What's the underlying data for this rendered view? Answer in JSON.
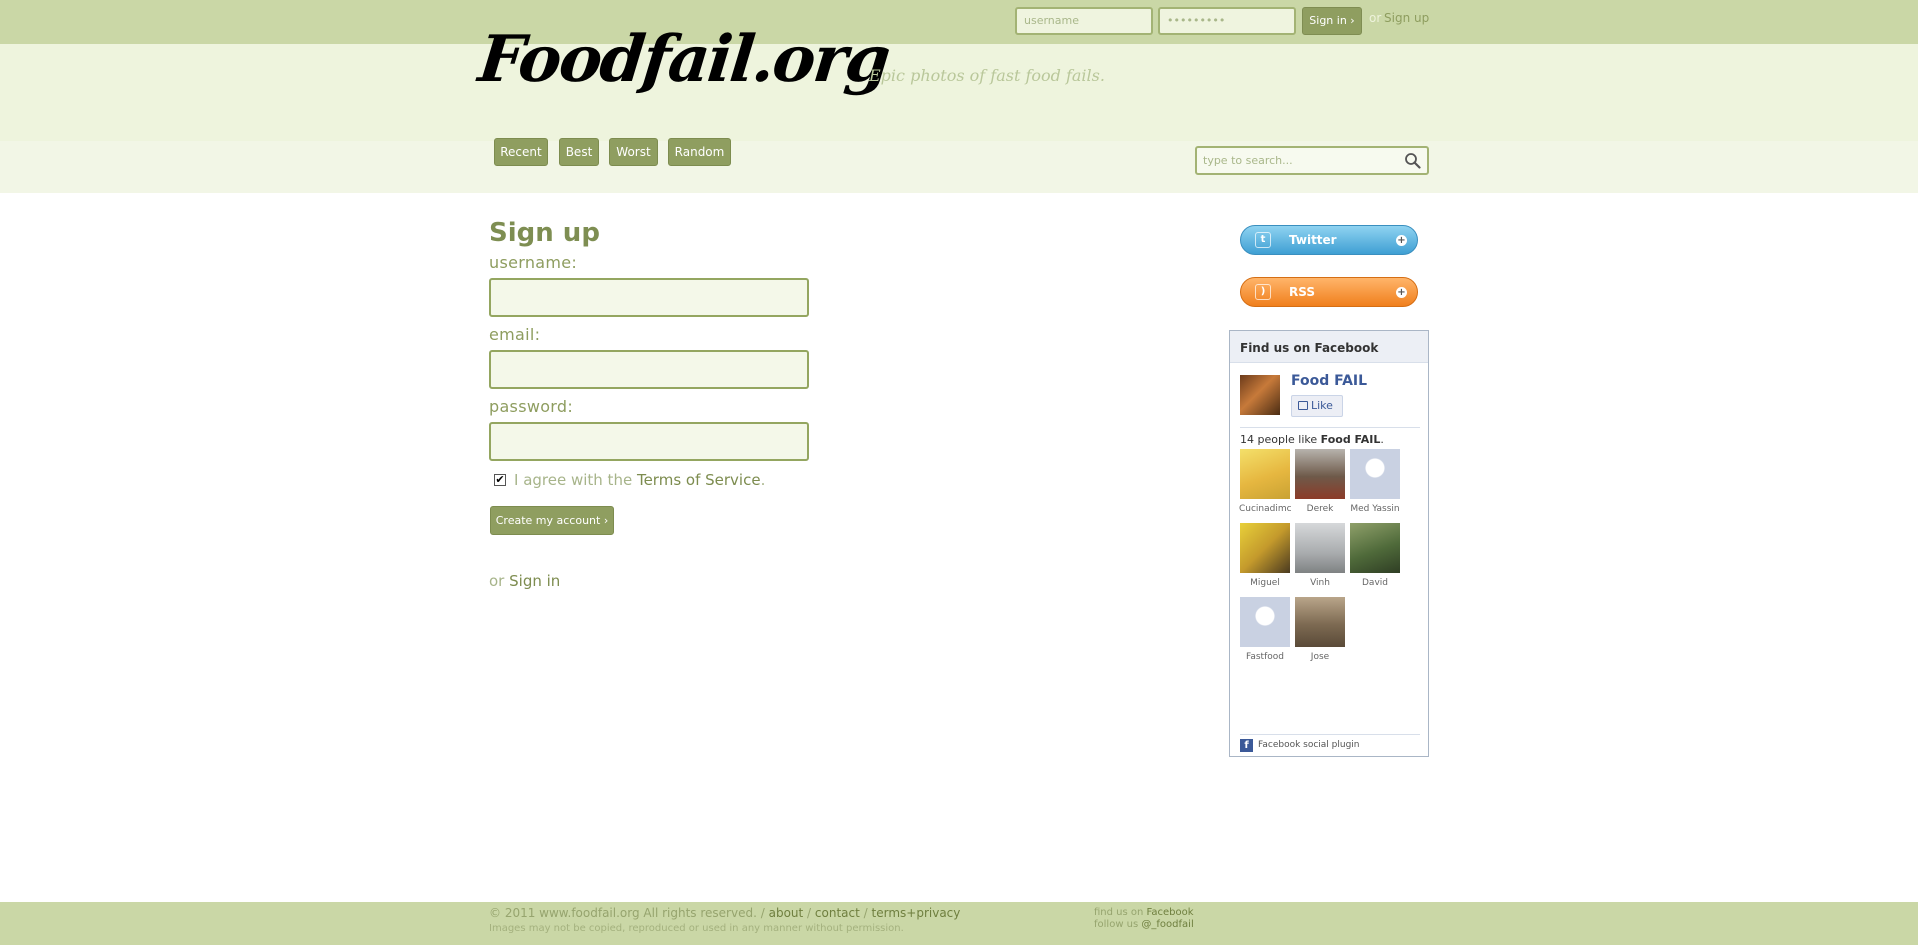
{
  "topbar": {
    "username_placeholder": "username",
    "password_value": "•••••••••",
    "signin_label": "Sign in ›",
    "or_text": "or",
    "signup_label": "Sign up"
  },
  "header": {
    "logo": "Foodfail.org",
    "tagline": "Epic photos of fast food fails."
  },
  "nav": {
    "items": [
      {
        "label": "Recent"
      },
      {
        "label": "Best"
      },
      {
        "label": "Worst"
      },
      {
        "label": "Random"
      }
    ]
  },
  "search": {
    "placeholder": "type to search..."
  },
  "signup_form": {
    "title": "Sign up",
    "username_label": "username:",
    "email_label": "email:",
    "password_label": "password:",
    "agree_prefix": "I agree with the",
    "tos_link": "Terms of Service",
    "agree_suffix": ".",
    "agree_checked": true,
    "submit_label": "Create my account ›",
    "or_text": "or",
    "signin_link": "Sign in"
  },
  "sidebar": {
    "twitter_label": "Twitter",
    "rss_label": "RSS",
    "facebook": {
      "title": "Find us on Facebook",
      "page_name": "Food FAIL",
      "like_label": "Like",
      "count_prefix": "14 people like",
      "count_page": "Food FAIL",
      "count_suffix": ".",
      "fans": [
        {
          "name": "Cucinadimc"
        },
        {
          "name": "Derek"
        },
        {
          "name": "Med Yassin"
        },
        {
          "name": "Miguel"
        },
        {
          "name": "Vinh"
        },
        {
          "name": "David"
        },
        {
          "name": "Fastfood"
        },
        {
          "name": "Jose"
        }
      ],
      "plugin_label": "Facebook social plugin"
    }
  },
  "footer": {
    "copyright": "© 2011 www.foodfail.org All rights reserved. /",
    "about": "about",
    "contact": "contact",
    "terms": "terms+privacy",
    "sep": "/",
    "note": "Images may not be copied, reproduced or used in any manner without permission.",
    "find_prefix": "find us on",
    "find_link": "Facebook",
    "follow_prefix": "follow us",
    "follow_link": "@_foodfail"
  },
  "colors": {
    "bar_green": "#cad7a6",
    "button_green": "#8f9e60",
    "header_bg": "#eef4dd",
    "facebook_blue": "#3b5998"
  }
}
